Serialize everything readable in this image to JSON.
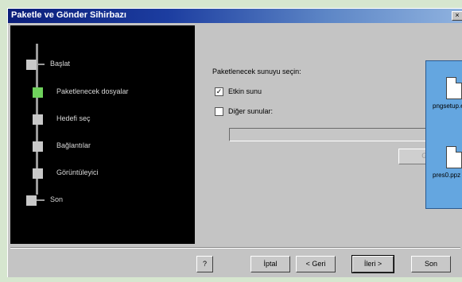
{
  "window": {
    "title": "Paketle ve Gönder Sihirbazı",
    "close_glyph": "×"
  },
  "steps": [
    {
      "label": "Başlat",
      "active": false
    },
    {
      "label": "Paketlenecek dosyalar",
      "active": true
    },
    {
      "label": "Hedefi seç",
      "active": false
    },
    {
      "label": "Bağlantılar",
      "active": false
    },
    {
      "label": "Görüntüleyici",
      "active": false
    },
    {
      "label": "Son",
      "active": false
    }
  ],
  "main": {
    "heading": "Paketlenecek sunuyu seçin:",
    "option_active": {
      "label": "Etkin sunu",
      "checked": true,
      "check_glyph": "✓"
    },
    "option_other": {
      "label": "Diğer sunular:",
      "checked": false
    },
    "path_value": "",
    "browse_label": "Gözat..."
  },
  "popup": {
    "item1_label": "pngsetup.exe",
    "item2_label": "pres0.ppz",
    "icon1": "document-icon",
    "icon2": "document-icon"
  },
  "buttons": {
    "help": "?",
    "cancel": "İptal",
    "back": "< Geri",
    "next": "İleri >",
    "finish": "Son"
  }
}
